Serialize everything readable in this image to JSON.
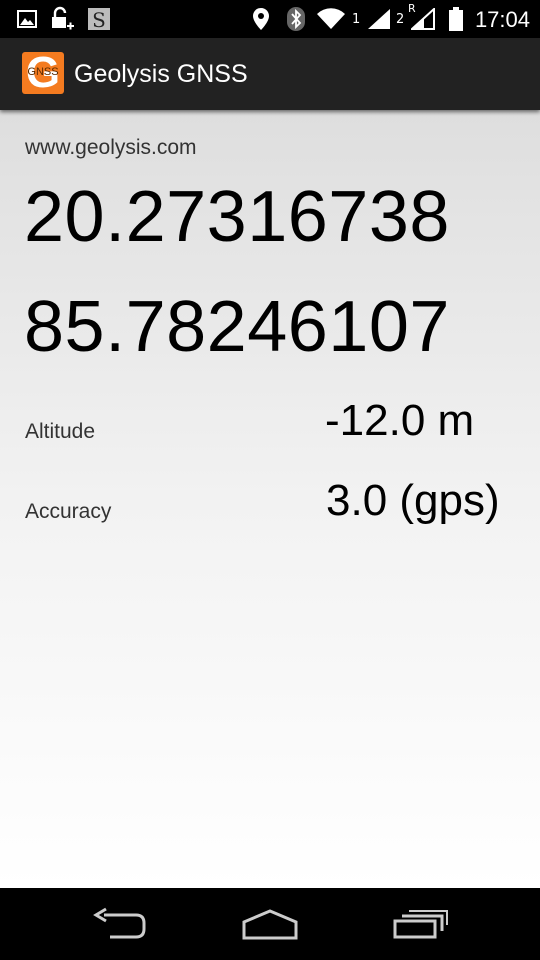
{
  "status_bar": {
    "sim1_label": "1",
    "sim2_label": "2",
    "roaming_label": "R",
    "time": "17:04",
    "icons": [
      "gallery-icon",
      "lock-plus-icon",
      "s-app-icon",
      "location-icon",
      "bluetooth-icon",
      "wifi-icon",
      "signal-1-icon",
      "signal-2-icon",
      "battery-icon"
    ]
  },
  "action_bar": {
    "app_icon_letter": "G",
    "app_icon_text": "GNSS",
    "title": "Geolysis GNSS",
    "app_icon_color": "#f47b20"
  },
  "main": {
    "website": "www.geolysis.com",
    "latitude": "20.27316738",
    "longitude": "85.78246107",
    "altitude_label": "Altitude",
    "altitude_value": "-12.0 m",
    "accuracy_label": "Accuracy",
    "accuracy_value": "3.0 (gps)"
  },
  "nav_bar": {
    "icons": [
      "back-icon",
      "home-icon",
      "recent-apps-icon"
    ]
  }
}
